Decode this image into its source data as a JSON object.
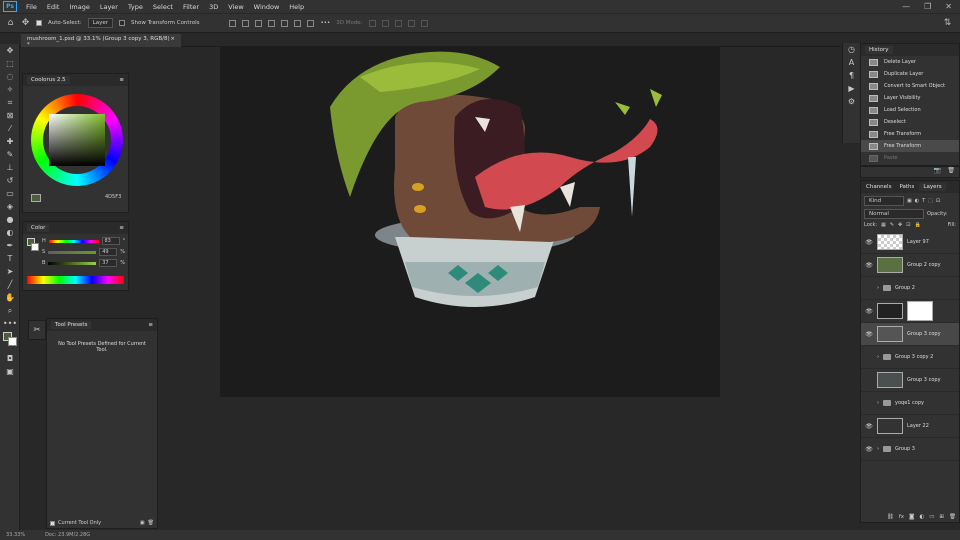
{
  "app": {
    "logo": "Ps"
  },
  "menu": [
    "File",
    "Edit",
    "Image",
    "Layer",
    "Type",
    "Select",
    "Filter",
    "3D",
    "View",
    "Window",
    "Help"
  ],
  "window_controls": [
    "—",
    "❐",
    "✕"
  ],
  "options": {
    "auto_select_label": "Auto-Select:",
    "auto_select_value": "Layer",
    "show_transform_label": "Show Transform Controls",
    "mode_3d_label": "3D Mode:"
  },
  "document_tab": {
    "title": "mushroom_1.psd @ 33.1% (Group 3 copy 3, RGB/8) *",
    "close": "×"
  },
  "colors_panel": {
    "title": "Coolorus 2.5",
    "hex": "4D5F3"
  },
  "color_panel": {
    "title": "Color",
    "h": {
      "label": "H",
      "value": "83",
      "unit": "°"
    },
    "s": {
      "label": "S",
      "value": "49",
      "unit": "%"
    },
    "b": {
      "label": "B",
      "value": "37",
      "unit": "%"
    }
  },
  "tool_presets": {
    "title": "Tool Presets",
    "empty_msg": "No Tool Presets Defined for Current Tool.",
    "footer": "Current Tool Only"
  },
  "history": {
    "title": "History",
    "items": [
      {
        "label": "Delete Layer"
      },
      {
        "label": "Duplicate Layer"
      },
      {
        "label": "Convert to Smart Object"
      },
      {
        "label": "Layer Visibility"
      },
      {
        "label": "Load Selection"
      },
      {
        "label": "Deselect"
      },
      {
        "label": "Free Transform"
      },
      {
        "label": "Free Transform"
      },
      {
        "label": "Paste"
      }
    ]
  },
  "layers_panel": {
    "tabs": [
      "Channels",
      "Paths",
      "Layers"
    ],
    "kind_label": "Kind",
    "blend_mode": "Normal",
    "opacity_label": "Opacity:",
    "lock_label": "Lock:",
    "fill_label": "Fill:",
    "layers": [
      {
        "name": "Layer 97",
        "visible": true,
        "type": "layer"
      },
      {
        "name": "Group 2 copy",
        "visible": true,
        "type": "layer"
      },
      {
        "name": "Group 2",
        "visible": false,
        "type": "group"
      },
      {
        "name": "",
        "visible": true,
        "type": "mask"
      },
      {
        "name": "Group 3 copy",
        "visible": true,
        "type": "layer"
      },
      {
        "name": "Group 3 copy 2",
        "visible": false,
        "type": "group"
      },
      {
        "name": "Group 3 copy",
        "visible": false,
        "type": "layer"
      },
      {
        "name": "yoqe1 copy",
        "visible": false,
        "type": "group"
      },
      {
        "name": "Layer 22",
        "visible": true,
        "type": "layer"
      },
      {
        "name": "Group 3",
        "visible": true,
        "type": "group"
      }
    ]
  },
  "status": {
    "zoom": "33.33%",
    "doc": "Doc: 23.9M/2.28G"
  }
}
